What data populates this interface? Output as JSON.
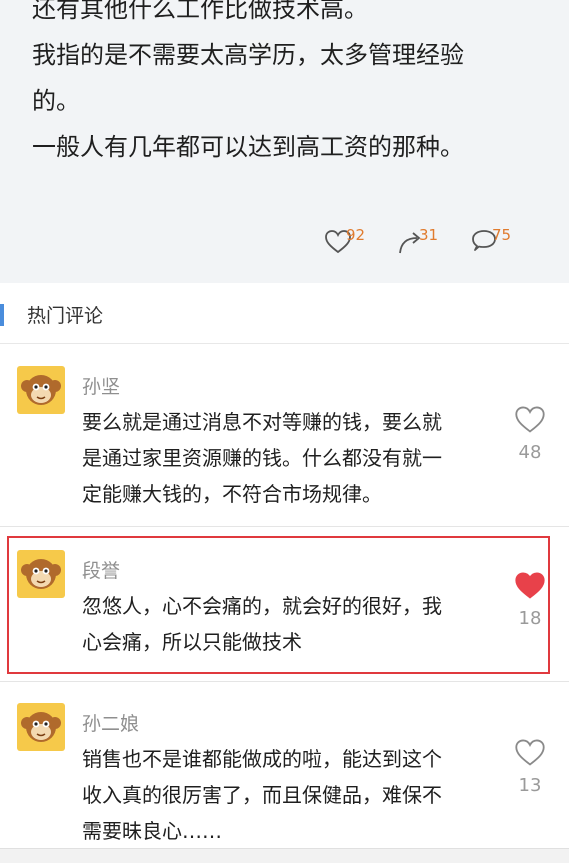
{
  "post": {
    "lines": [
      "还有其他什么工作比做技术高。",
      "我指的是不需要太高学历，太多管理经验",
      "的。",
      "一般人有几年都可以达到高工资的那种。"
    ],
    "likes": "92",
    "reposts": "31",
    "comments": "75"
  },
  "section": {
    "title": "热门评论"
  },
  "comments": [
    {
      "name": "孙坚",
      "lines": [
        "要么就是通过消息不对等赚的钱，要么就",
        "是通过家里资源赚的钱。什么都没有就一",
        "定能赚大钱的，不符合市场规律。"
      ],
      "likes": "48",
      "liked": false
    },
    {
      "name": "段誉",
      "lines": [
        "忽悠人，心不会痛的，就会好的很好，我",
        "心会痛，所以只能做技术"
      ],
      "likes": "18",
      "liked": true
    },
    {
      "name": "孙二娘",
      "lines": [
        "销售也不是谁都能做成的啦，能达到这个",
        "收入真的很厉害了，而且保健品，难保不",
        "需要昧良心……"
      ],
      "likes": "13",
      "liked": false
    }
  ],
  "colors": {
    "accent_orange": "#e07b2e",
    "liked_red": "#e8414a",
    "section_bar_blue": "#4a8ddc",
    "highlight_red": "#e0393e",
    "avatar_yellow": "#f6c94a"
  },
  "icons": {
    "like": "heart-icon",
    "repost": "repost-icon",
    "comment": "comment-bubble-icon",
    "avatar": "monkey-avatar-icon"
  }
}
